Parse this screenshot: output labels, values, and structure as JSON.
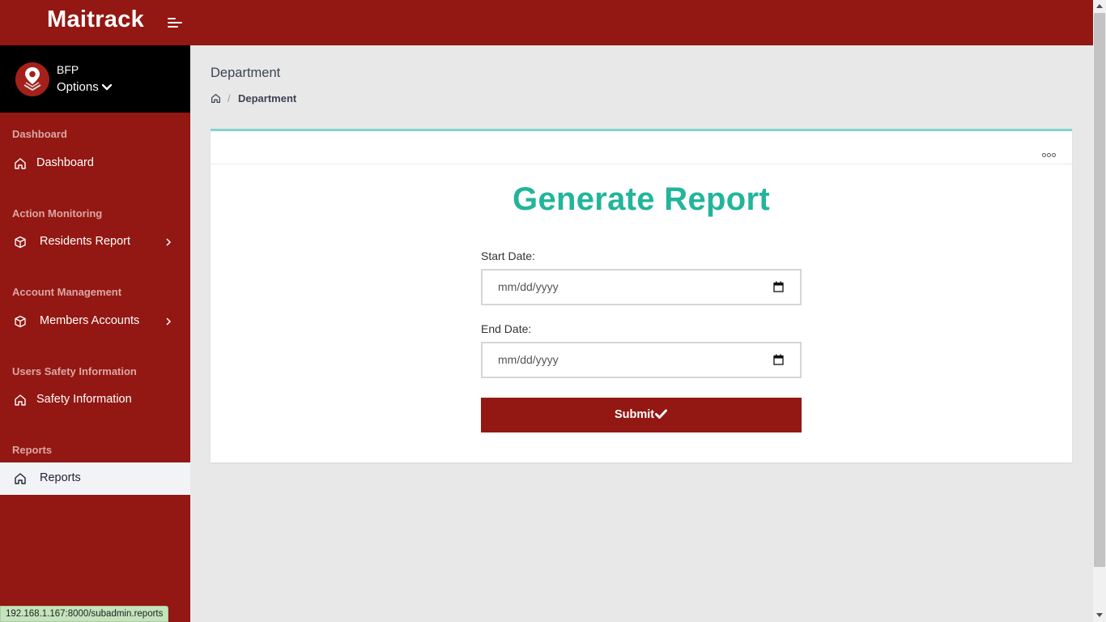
{
  "app": {
    "brand": "Maitrack"
  },
  "user": {
    "name": "BFP",
    "options_label": "Options"
  },
  "sidebar": {
    "sections": [
      {
        "heading": "Dashboard",
        "items": [
          {
            "label": "Dashboard",
            "icon": "home-icon",
            "has_submenu": false,
            "active": false
          }
        ]
      },
      {
        "heading": "Action Monitoring",
        "items": [
          {
            "label": "Residents Report",
            "icon": "cube-icon",
            "has_submenu": true,
            "active": false
          }
        ]
      },
      {
        "heading": "Account Management",
        "items": [
          {
            "label": "Members Accounts",
            "icon": "cube-icon",
            "has_submenu": true,
            "active": false
          }
        ]
      },
      {
        "heading": "Users Safety Information",
        "items": [
          {
            "label": "Safety Information",
            "icon": "home-icon",
            "has_submenu": false,
            "active": false
          }
        ]
      },
      {
        "heading": "Reports",
        "items": [
          {
            "label": "Reports",
            "icon": "home-icon",
            "has_submenu": false,
            "active": true
          }
        ]
      }
    ]
  },
  "page": {
    "title": "Department",
    "breadcrumb": {
      "home_icon": "home-icon",
      "current": "Department"
    }
  },
  "card": {
    "menu_icon": "more-horizontal-icon",
    "title": "Generate Report",
    "start_date": {
      "label": "Start Date:",
      "placeholder": "mm/dd/yyyy"
    },
    "end_date": {
      "label": "End Date:",
      "placeholder": "mm/dd/yyyy"
    },
    "submit_label": "Submit",
    "submit_icon": "check-icon"
  },
  "status_bar": {
    "url": "192.168.1.167:8000/subadmin.reports"
  },
  "colors": {
    "primary": "#931712",
    "user_panel": "#000000",
    "accent_green": "#22b59b",
    "card_top_border": "#82d3cc",
    "content_bg": "#e8e8e8",
    "active_item_bg": "#f2f3f7",
    "section_heading": "#dba8a6"
  }
}
